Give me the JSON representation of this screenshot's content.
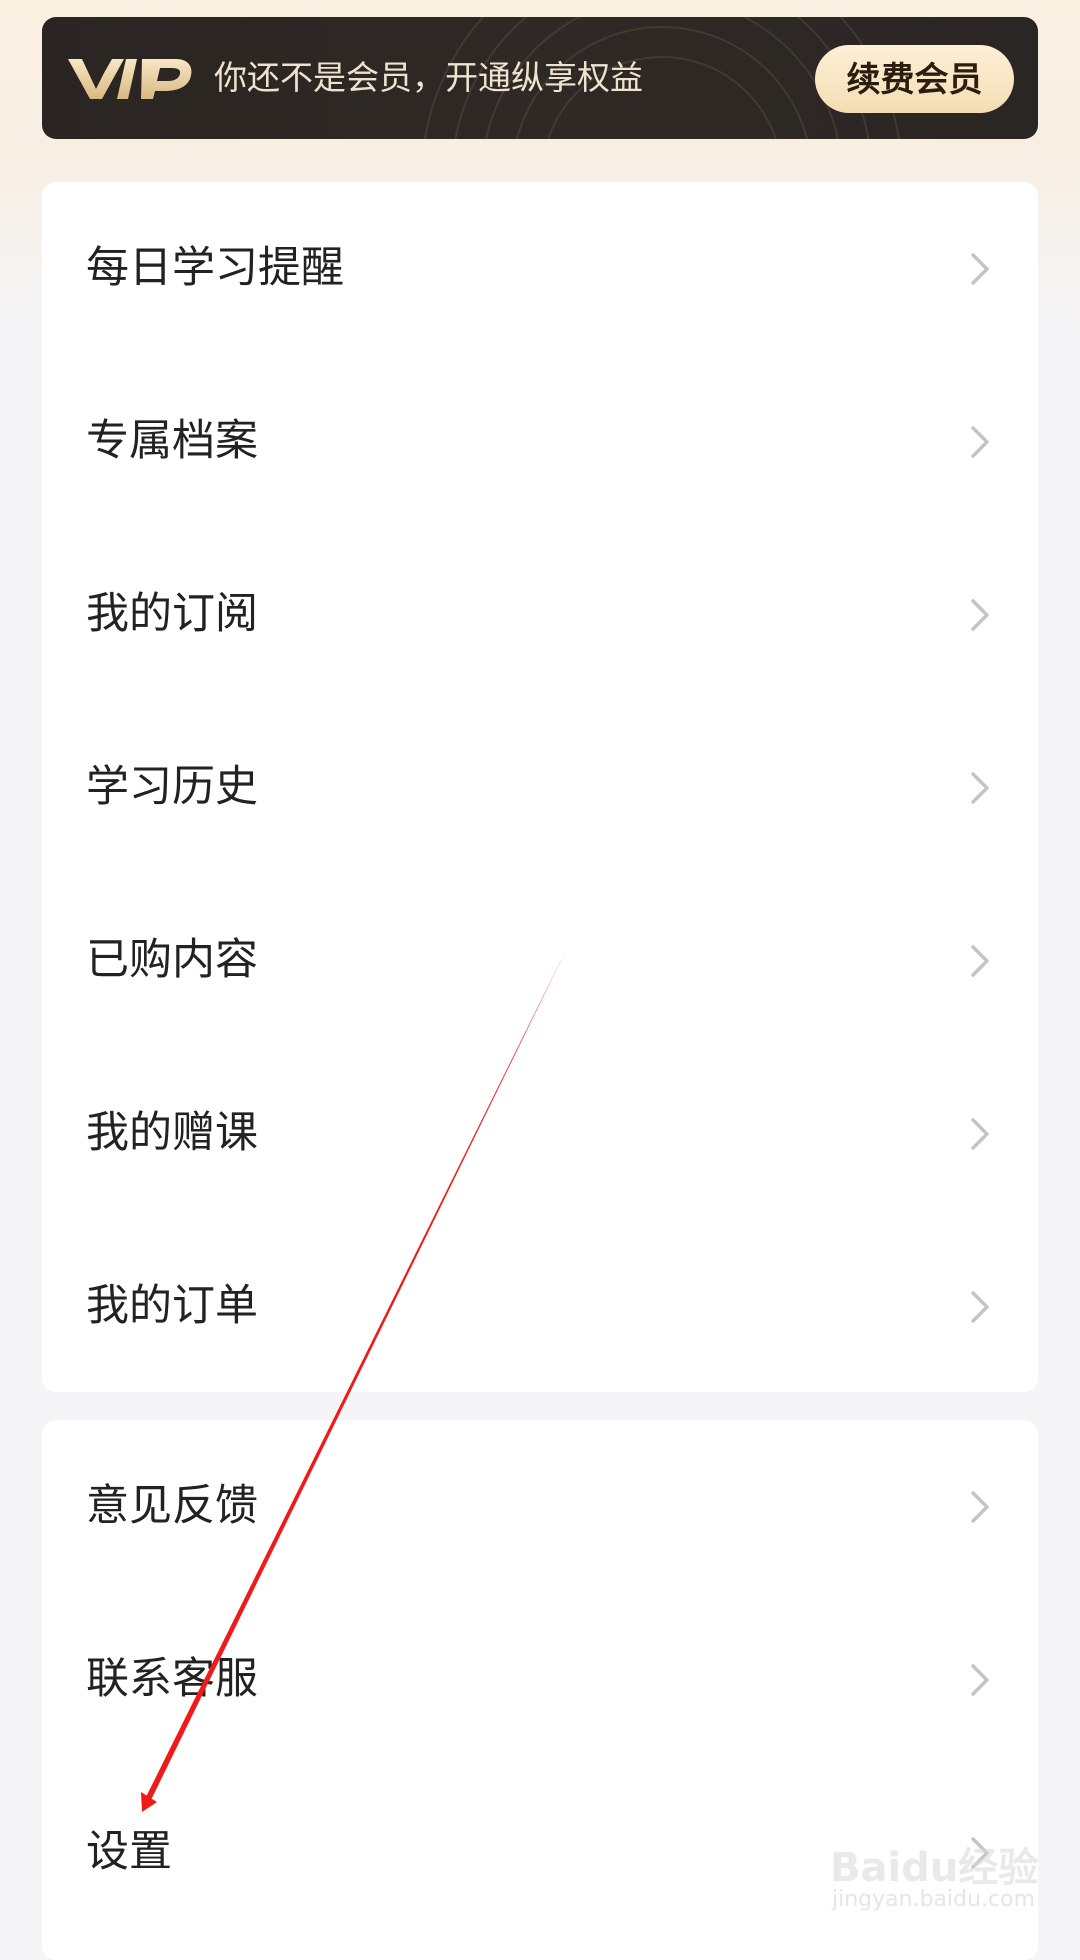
{
  "vip_banner": {
    "logo_text": "VIP",
    "message": "你还不是会员，开通纵享权益",
    "renew_button": "续费会员"
  },
  "menu_group_1": [
    {
      "label": "每日学习提醒"
    },
    {
      "label": "专属档案"
    },
    {
      "label": "我的订阅"
    },
    {
      "label": "学习历史"
    },
    {
      "label": "已购内容"
    },
    {
      "label": "我的赠课"
    },
    {
      "label": "我的订单"
    }
  ],
  "menu_group_2": [
    {
      "label": "意见反馈"
    },
    {
      "label": "联系客服"
    },
    {
      "label": "设置"
    }
  ],
  "watermark": {
    "brand": "Baidu经验",
    "url": "jingyan.baidu.com"
  },
  "icons": {
    "row_chevron": "chevron-right-icon",
    "vip_logo": "vip-logo"
  },
  "colors": {
    "banner_bg": "#2a2522",
    "banner_text": "#efe3cf",
    "renew_bg": "#f6e1bb",
    "annotation": "#f01a1a",
    "chevron": "#c4c4c4"
  }
}
